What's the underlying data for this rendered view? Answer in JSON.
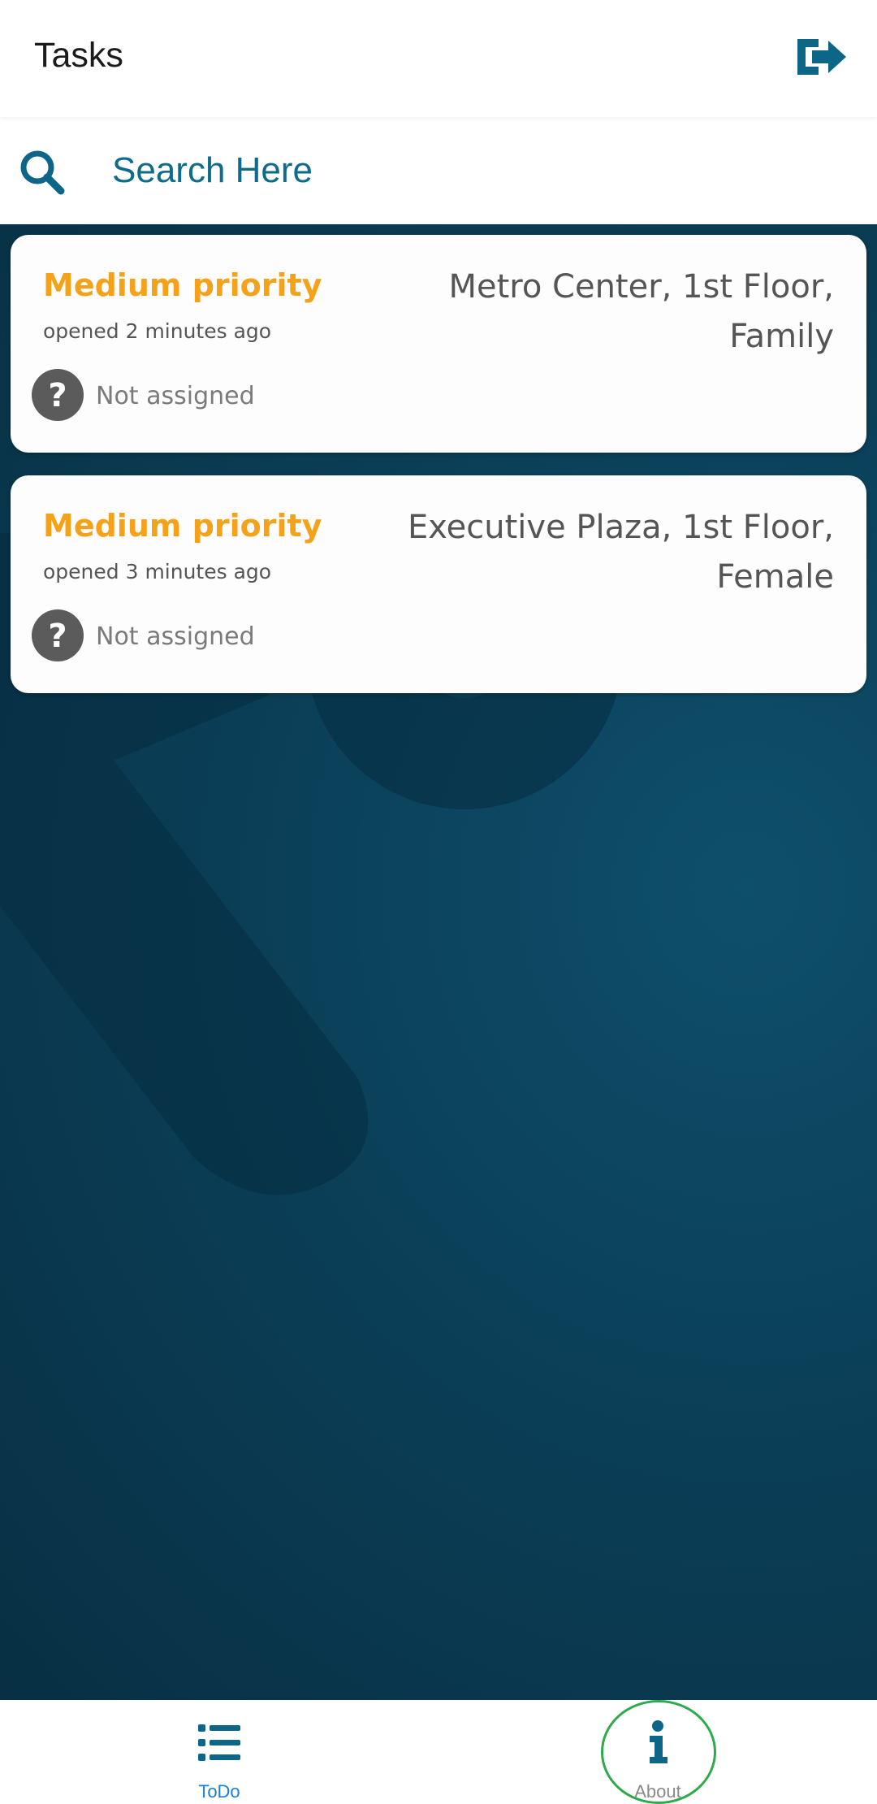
{
  "header": {
    "title": "Tasks",
    "logout_icon": "sign-out-icon"
  },
  "search": {
    "placeholder": "Search Here",
    "value": "",
    "icon": "search-icon"
  },
  "tasks": [
    {
      "priority": "Medium priority",
      "opened": "opened 2 minutes ago",
      "location": "Metro Center, 1st Floor, Family",
      "assignee": "Not assigned",
      "assignee_icon": "question-circle-icon"
    },
    {
      "priority": "Medium priority",
      "opened": "opened 3 minutes ago",
      "location": "Executive Plaza, 1st Floor, Female",
      "assignee": "Not assigned",
      "assignee_icon": "question-circle-icon"
    }
  ],
  "bottom_nav": {
    "items": [
      {
        "label": "ToDo",
        "icon": "list-icon",
        "active": true
      },
      {
        "label": "About",
        "icon": "info-icon",
        "active": false
      }
    ]
  },
  "colors": {
    "accent": "#0f6b8a",
    "priority_medium": "#f5a21b",
    "background_dark": "#0b415a",
    "nav_active": "#1a7fd6",
    "highlight": "#2eaa4c"
  }
}
